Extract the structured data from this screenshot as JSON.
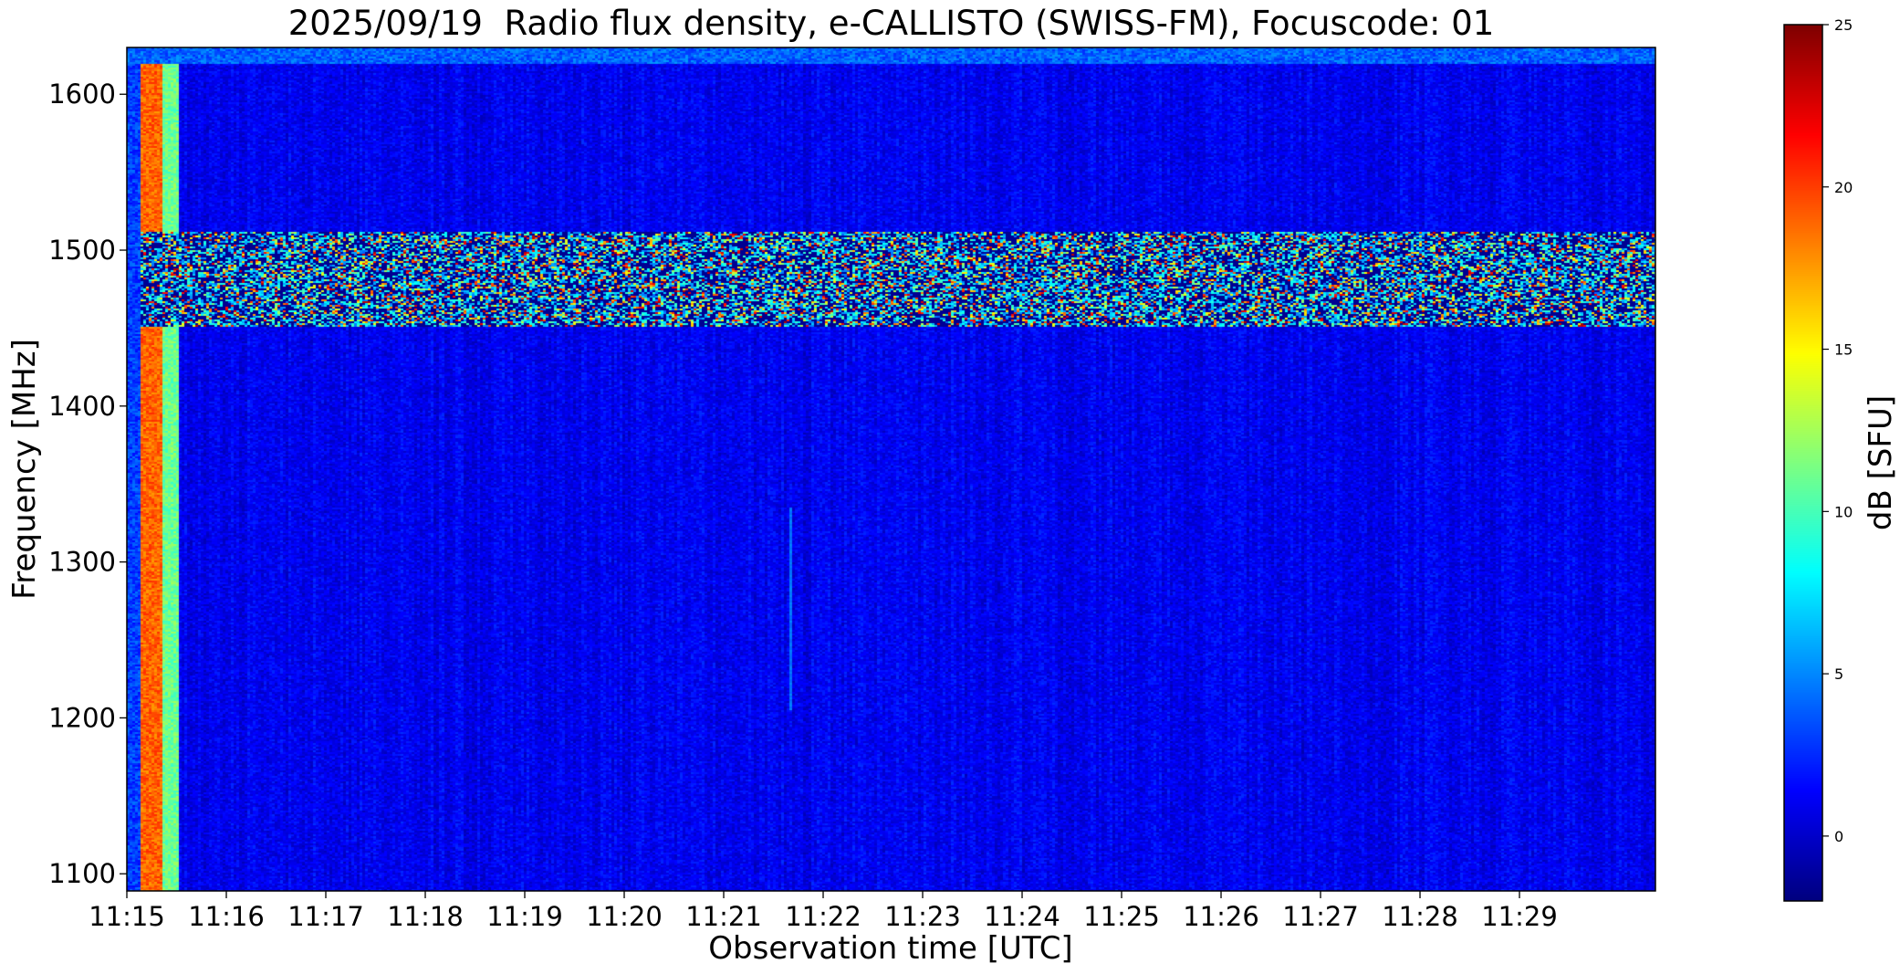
{
  "chart_data": {
    "type": "heatmap",
    "title": "2025/09/19  Radio flux density, e-CALLISTO (SWISS-FM), Focuscode: 01",
    "xlabel": "Observation time [UTC]",
    "ylabel": "Frequency [MHz]",
    "x_ticks": [
      "11:15",
      "11:16",
      "11:17",
      "11:18",
      "11:19",
      "11:20",
      "11:21",
      "11:22",
      "11:23",
      "11:24",
      "11:25",
      "11:26",
      "11:27",
      "11:28",
      "11:29"
    ],
    "xlim": [
      "11:15:00",
      "11:30:22"
    ],
    "y_ticks": [
      1100,
      1200,
      1300,
      1400,
      1500,
      1600
    ],
    "ylim": [
      1089,
      1630
    ],
    "colorbar": {
      "label": "dB [SFU]",
      "colormap": "jet",
      "ticks": [
        0,
        5,
        10,
        15,
        20,
        25
      ],
      "range": [
        -2,
        25
      ]
    },
    "background_level_db": 1,
    "features": [
      {
        "time_range": [
          "11:15:00",
          "11:15:08"
        ],
        "freq_range": [
          1089,
          1630
        ],
        "level_db": 3
      },
      {
        "time_range": [
          "11:15:08",
          "11:15:20"
        ],
        "freq_range": [
          1089,
          1630
        ],
        "level_db": 19
      },
      {
        "time_range": [
          "11:15:20",
          "11:15:31"
        ],
        "freq_range": [
          1089,
          1630
        ],
        "level_db": 11
      },
      {
        "time_range": [
          "11:15:00",
          "11:30:22"
        ],
        "freq_range": [
          1451,
          1512
        ],
        "level_db": 6,
        "noise": "strong interference band"
      },
      {
        "time_range": [
          "11:15:00",
          "11:30:22"
        ],
        "freq_range": [
          1620,
          1630
        ],
        "level_db": 4
      },
      {
        "time_range": [
          "11:21:38",
          "11:21:41"
        ],
        "freq_range": [
          1205,
          1335
        ],
        "level_db": 4
      }
    ],
    "grid": false
  }
}
